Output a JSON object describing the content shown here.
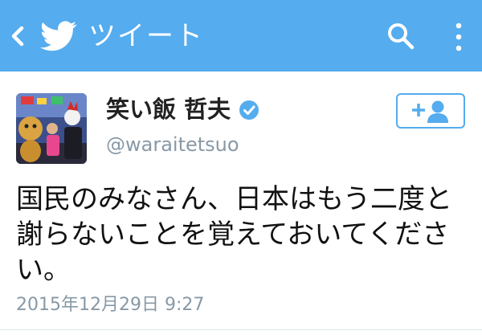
{
  "header": {
    "title": "ツイート",
    "back_icon": "chevron-left-icon",
    "logo_icon": "twitter-bird-icon",
    "search_icon": "search-icon",
    "menu_icon": "more-vertical-icon",
    "bar_color": "#55acee"
  },
  "tweet": {
    "author_name": "笑い飯 哲夫",
    "verified": true,
    "handle": "@waraitetsuo",
    "text": "国民のみなさん、日本はもう二度と謝らないことを覚えておいてください。",
    "timestamp": "2015年12月29日 9:27"
  },
  "follow_button": {
    "icon": "add-user-icon",
    "color": "#55acee"
  }
}
